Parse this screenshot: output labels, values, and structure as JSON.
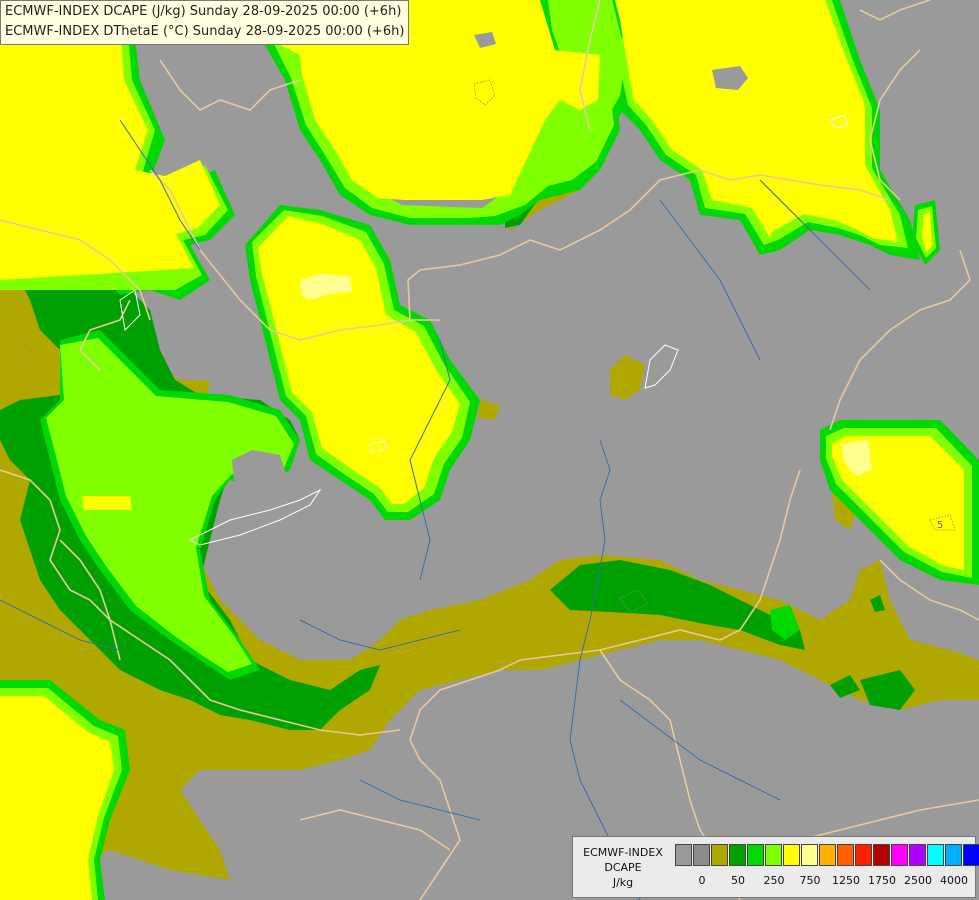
{
  "header": {
    "line1": "ECMWF-INDEX DCAPE (J/kg) Sunday 28-09-2025 00:00 (+6h)",
    "line2": "ECMWF-INDEX DThetaE (°C) Sunday 28-09-2025 00:00 (+6h)"
  },
  "legend": {
    "caption_lines": [
      "ECMWF-INDEX",
      "DCAPE",
      "J/kg"
    ],
    "swatches": [
      "#9a9a9a",
      "#8c8c8c",
      "#b0a800",
      "#00a000",
      "#00d800",
      "#80ff00",
      "#ffff00",
      "#ffff90",
      "#ffb000",
      "#ff6000",
      "#ff2000",
      "#b00000",
      "#ff00ff",
      "#b000ff",
      "#00ffff",
      "#00b0ff",
      "#0000ff",
      "#000090"
    ],
    "tick_labels": [
      {
        "label": "0",
        "index": 1
      },
      {
        "label": "50",
        "index": 3
      },
      {
        "label": "250",
        "index": 5
      },
      {
        "label": "750",
        "index": 7
      },
      {
        "label": "1250",
        "index": 9
      },
      {
        "label": "1750",
        "index": 11
      },
      {
        "label": "2500",
        "index": 13
      },
      {
        "label": "4000",
        "index": 15
      }
    ]
  },
  "map_annotation": "5",
  "colors": {
    "background_gray": "#9a9a9a",
    "olive": "#b0a800",
    "dark_green": "#00a000",
    "green": "#00d800",
    "light_green": "#80ff00",
    "yellow": "#ffff00",
    "pale_yellow": "#ffff90",
    "borders": "#e8c8a0",
    "rivers": "#3a6ea8"
  }
}
